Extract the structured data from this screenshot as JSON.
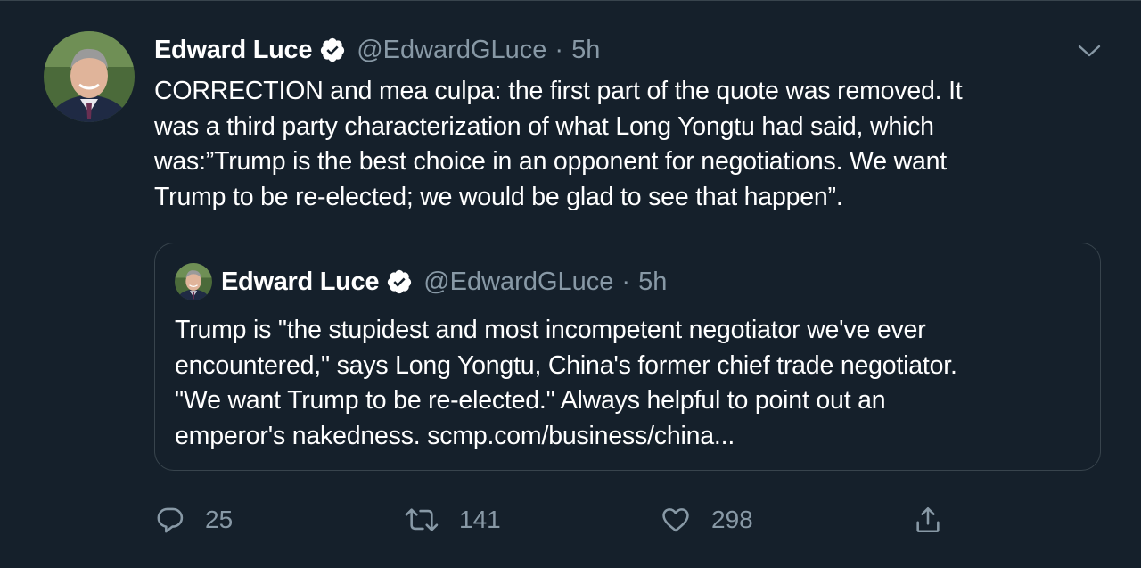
{
  "tweet": {
    "author_name": "Edward Luce",
    "author_handle": "@EdwardGLuce",
    "separator": "·",
    "time": "5h",
    "text_lines": [
      "CORRECTION and mea culpa: the first part of the quote was removed. It",
      "was a third party characterization of what Long Yongtu had said, which",
      "was:”Trump is the best choice in an opponent for negotiations. We want",
      "Trump to be re-elected; we would be glad to see that happen”."
    ],
    "icons": {
      "verified": "verified-badge-icon",
      "more": "chevron-down-icon"
    }
  },
  "quoted_tweet": {
    "author_name": "Edward Luce",
    "author_handle": "@EdwardGLuce",
    "separator": "·",
    "time": "5h",
    "text_lines": [
      "Trump is \"the stupidest and most incompetent negotiator we've ever",
      "encountered,\" says Long Yongtu, China's former chief trade negotiator.",
      "\"We want Trump to be re-elected.\" Always helpful to point out an",
      "emperor's nakedness.  scmp.com/business/china..."
    ]
  },
  "actions": {
    "reply": {
      "icon": "reply-icon",
      "count": "25"
    },
    "retweet": {
      "icon": "retweet-icon",
      "count": "141"
    },
    "like": {
      "icon": "heart-icon",
      "count": "298"
    },
    "share": {
      "icon": "share-icon"
    }
  },
  "colors": {
    "background": "#15202b",
    "text_primary": "#ffffff",
    "text_secondary": "#8899a6",
    "border": "#38444d",
    "verified_badge": "#ffffff"
  }
}
